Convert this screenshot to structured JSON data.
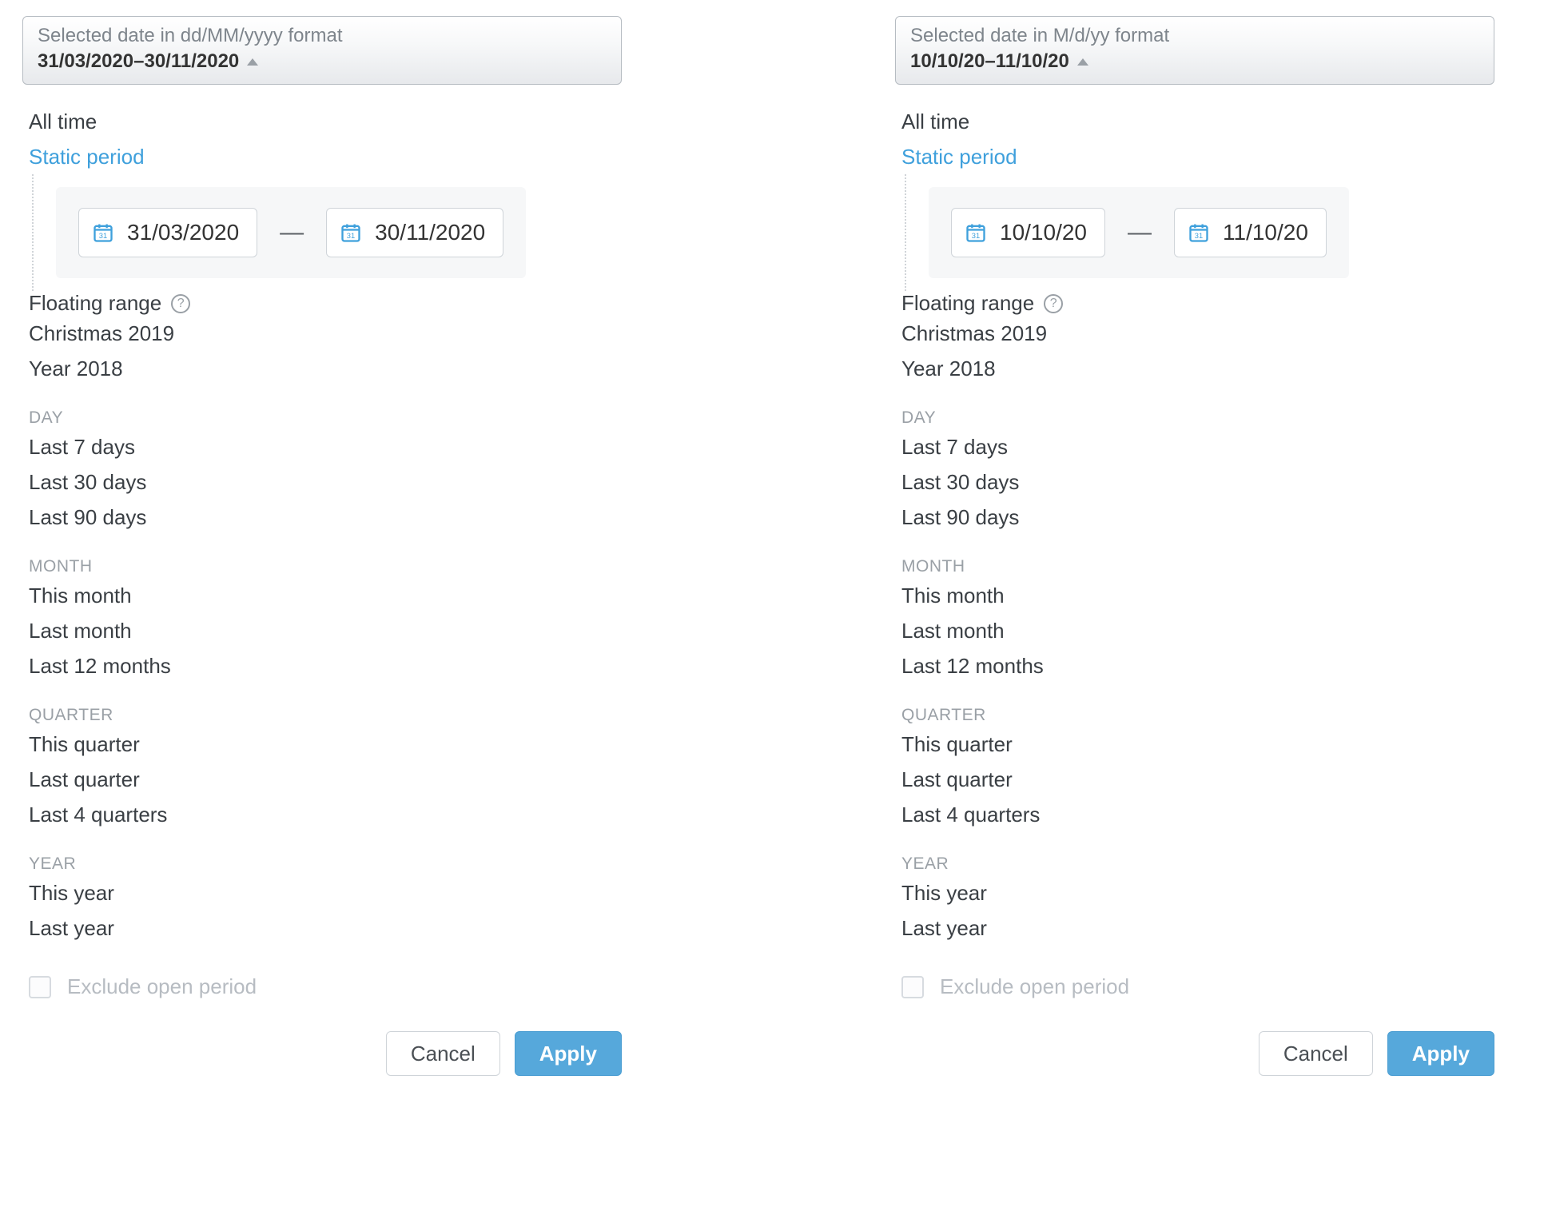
{
  "panels": [
    {
      "header": {
        "caption": "Selected date in dd/MM/yyyy format",
        "range": "31/03/2020–30/11/2020"
      },
      "static": {
        "from": "31/03/2020",
        "to": "30/11/2020"
      }
    },
    {
      "header": {
        "caption": "Selected date in M/d/yy format",
        "range": "10/10/20–11/10/20"
      },
      "static": {
        "from": "10/10/20",
        "to": "11/10/20"
      }
    }
  ],
  "options": {
    "all_time": "All time",
    "static_period": "Static period",
    "floating_range": "Floating range",
    "preset_christmas": "Christmas 2019",
    "preset_year": "Year 2018",
    "day_label": "DAY",
    "day": [
      "Last 7 days",
      "Last 30 days",
      "Last 90 days"
    ],
    "month_label": "MONTH",
    "month": [
      "This month",
      "Last month",
      "Last 12 months"
    ],
    "quarter_label": "QUARTER",
    "quarter": [
      "This quarter",
      "Last quarter",
      "Last 4 quarters"
    ],
    "year_label": "YEAR",
    "year": [
      "This year",
      "Last year"
    ]
  },
  "exclude_label": "Exclude open period",
  "buttons": {
    "cancel": "Cancel",
    "apply": "Apply"
  }
}
